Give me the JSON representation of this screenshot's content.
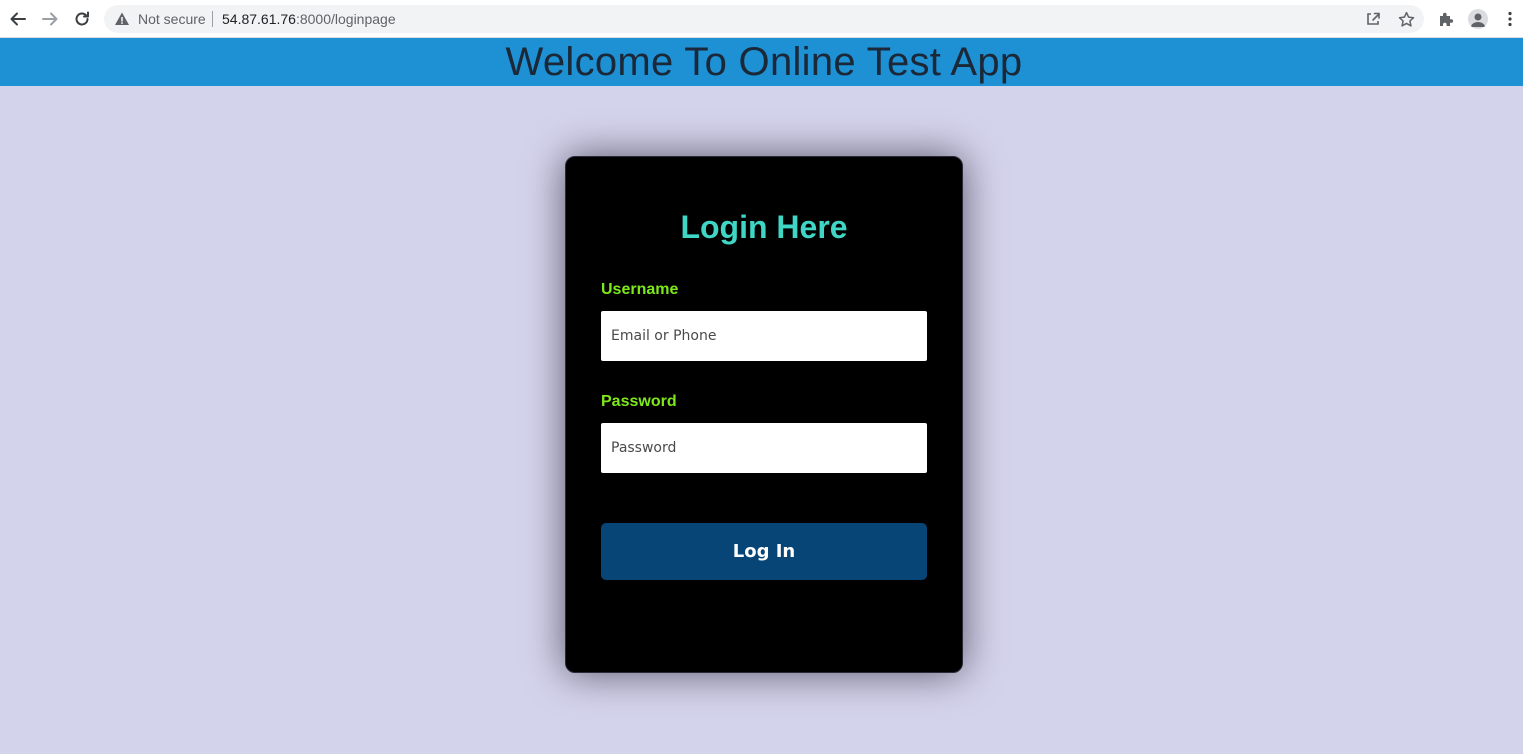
{
  "browser": {
    "security_label": "Not secure",
    "url_host": "54.87.61.76",
    "url_path": ":8000/loginpage"
  },
  "header": {
    "title": "Welcome To Online Test App",
    "background": "#1e90d4"
  },
  "login": {
    "title": "Login Here",
    "username_label": "Username",
    "username_placeholder": "Email or Phone",
    "username_value": "",
    "password_label": "Password",
    "password_placeholder": "Password",
    "password_value": "",
    "submit_label": "Log In"
  },
  "colors": {
    "page_background": "#d4d3ec",
    "card_background": "#000000",
    "title_color": "#3fd6c6",
    "label_color": "#7ee81a",
    "button_color": "#074577"
  },
  "icons": {
    "back": "arrow-left-icon",
    "forward": "arrow-right-icon",
    "reload": "reload-icon",
    "warning": "warning-triangle-icon",
    "share": "share-icon",
    "bookmark": "star-icon",
    "extensions": "puzzle-icon",
    "profile": "profile-icon",
    "menu": "kebab-menu-icon"
  }
}
